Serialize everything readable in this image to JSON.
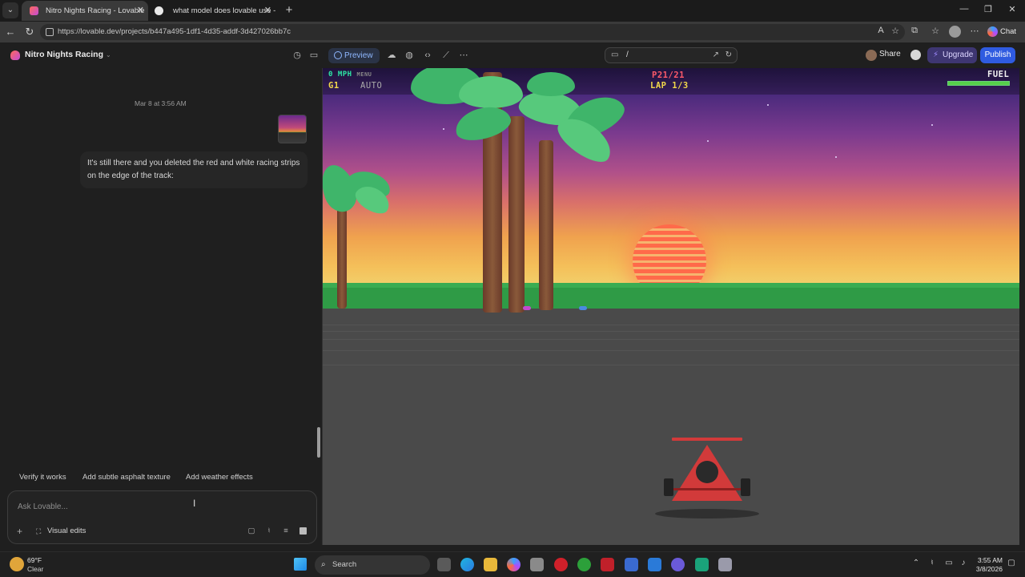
{
  "browser": {
    "tabs": [
      {
        "title": "Nitro Nights Racing - Lovable",
        "active": true
      },
      {
        "title": "what model does lovable use - Go",
        "active": false
      }
    ],
    "url": "https://lovable.dev/projects/b447a495-1df1-4d35-addf-3d427026bb7c",
    "copilot_label": "Chat"
  },
  "header": {
    "project_name": "Nitro Nights Racing",
    "preview_label": "Preview",
    "route": "/",
    "share_label": "Share",
    "upgrade_label": "Upgrade",
    "publish_label": "Publish"
  },
  "chat": {
    "date": "Mar 8 at 3:56 AM",
    "message": "It's still there and you deleted the red and white racing strips on the edge of the track:",
    "suggestions": [
      "Verify it works",
      "Add subtle asphalt texture",
      "Add weather effects"
    ],
    "input_placeholder": "Ask Lovable...",
    "visual_edits_label": "Visual edits"
  },
  "game": {
    "speed_label": "0 MPH",
    "menu_label": "MENU",
    "gear": "G1",
    "mode": "AUTO",
    "position": "P21/21",
    "lap": "LAP 1/3",
    "fuel_label": "FUEL",
    "fuel_level": 1.0,
    "colors": {
      "hud_green": "#2ee6a6",
      "hud_yellow": "#f2d84a",
      "hud_red": "#ff5a6a",
      "car_red": "#d23a3a"
    }
  },
  "taskbar": {
    "temperature": "69°F",
    "condition": "Clear",
    "search_label": "Search",
    "time": "3:55 AM",
    "date": "3/8/2026"
  }
}
